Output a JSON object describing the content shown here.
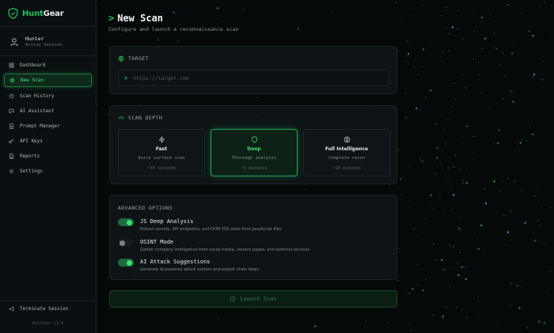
{
  "app": {
    "brand_part1": "Hunt",
    "brand_part2": "Gear",
    "version": "HuntGear v1.0"
  },
  "user": {
    "name": "Hunter",
    "status": "Active Session"
  },
  "nav": [
    {
      "label": "Dashboard",
      "icon": "dashboard-icon"
    },
    {
      "label": "New Scan",
      "icon": "target-icon",
      "active": true
    },
    {
      "label": "Scan History",
      "icon": "history-icon"
    },
    {
      "label": "AI Assistant",
      "icon": "chat-icon"
    },
    {
      "label": "Prompt Manager",
      "icon": "document-icon"
    },
    {
      "label": "API Keys",
      "icon": "key-icon"
    },
    {
      "label": "Reports",
      "icon": "report-icon"
    },
    {
      "label": "Settings",
      "icon": "gear-icon"
    }
  ],
  "terminate_label": "Terminate Session",
  "page": {
    "title": "New Scan",
    "subtitle": "Configure and launch a reconnaissance scan"
  },
  "target": {
    "label": "TARGET",
    "placeholder": "https://target.com",
    "value": ""
  },
  "depth": {
    "label": "SCAN DEPTH",
    "options": [
      {
        "name": "Fast",
        "desc": "Quick surface scan",
        "time": "~30 seconds",
        "icon": "lightning-icon"
      },
      {
        "name": "Deep",
        "desc": "Thorough analysis",
        "time": "~5 minutes",
        "icon": "shield-icon",
        "selected": true
      },
      {
        "name": "Full Intelligence",
        "desc": "Complete recon",
        "time": "~10 minutes",
        "icon": "brain-icon"
      }
    ]
  },
  "advanced": {
    "label": "ADVANCED OPTIONS",
    "options": [
      {
        "title": "JS Deep Analysis",
        "desc": "Extract secrets, API endpoints, and DOM XSS sinks from JavaScript files",
        "enabled": true
      },
      {
        "title": "OSINT Mode",
        "desc": "Gather company intelligence from social media, careers pages, and external services",
        "enabled": false
      },
      {
        "title": "AI Attack Suggestions",
        "desc": "Generate AI-powered attack vectors and exploit chain ideas",
        "enabled": true
      }
    ]
  },
  "launch_label": "Launch Scan",
  "colors": {
    "accent": "#22c55e",
    "background": "#05090a",
    "panel": "#0f1518"
  }
}
